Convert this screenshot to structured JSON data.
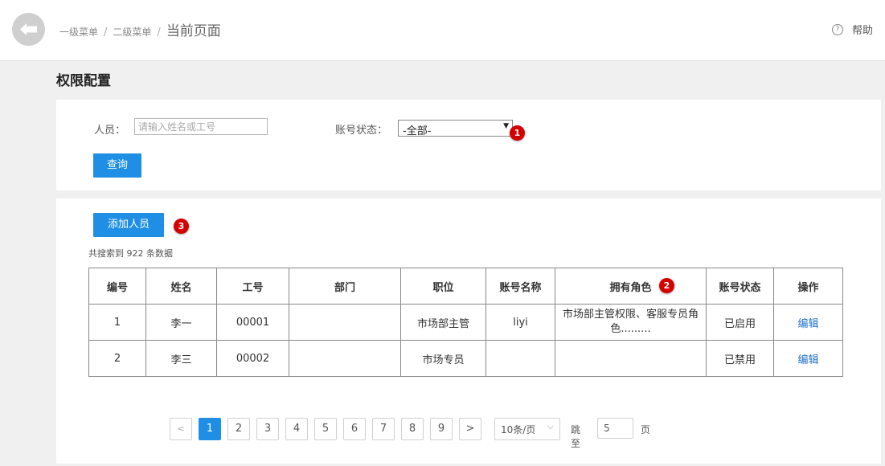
{
  "breadcrumb": {
    "level1": "一级菜单",
    "level2": "二级菜单",
    "separator": "/",
    "current": "当前页面"
  },
  "help": {
    "icon": "question-icon",
    "glyph": "?",
    "label": "帮助"
  },
  "page_title": "权限配置",
  "search": {
    "person_label": "人员：",
    "person_placeholder": "请输入姓名或工号",
    "status_label": "账号状态：",
    "status_value": "-全部-",
    "status_caret": "▼",
    "query_button": "查询"
  },
  "badges": {
    "b1": "1",
    "b2": "2",
    "b3": "3"
  },
  "list": {
    "add_button": "添加人员",
    "count_text": "共搜索到 922 条数据",
    "headers": [
      "编号",
      "姓名",
      "工号",
      "部门",
      "职位",
      "账号名称",
      "拥有角色",
      "账号状态",
      "操作"
    ],
    "rows": [
      {
        "no": "1",
        "name": "李一",
        "emp_id": "00001",
        "dept": "",
        "position": "市场部主管",
        "account": "liyi",
        "roles": "市场部主管权限、客服专员角色.........",
        "status": "已启用",
        "action": "编辑"
      },
      {
        "no": "2",
        "name": "李三",
        "emp_id": "00002",
        "dept": "",
        "position": "市场专员",
        "account": "",
        "roles": "",
        "status": "已禁用",
        "action": "编辑"
      }
    ]
  },
  "pagination": {
    "prev": "<",
    "next": ">",
    "pages": [
      "1",
      "2",
      "3",
      "4",
      "5",
      "6",
      "7",
      "8",
      "9"
    ],
    "current_page": "1",
    "page_size": "10条/页",
    "size_caret": "⌵",
    "jump_label": "跳至",
    "jump_value": "5",
    "page_unit": "页"
  },
  "colors": {
    "primary": "#1f8fe6",
    "badge": "#d40000",
    "link": "#1f6fc9",
    "background": "#f0f0f0"
  }
}
